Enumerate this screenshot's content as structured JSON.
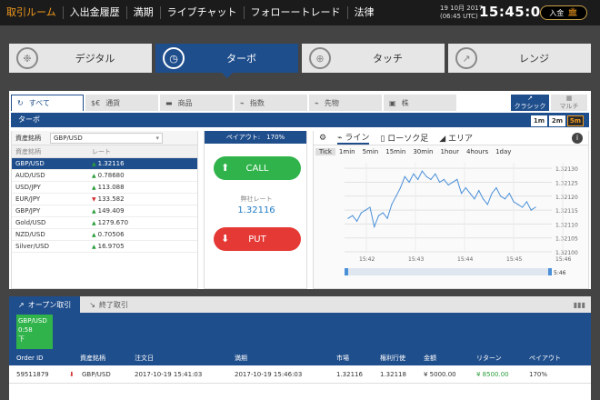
{
  "nav": {
    "items": [
      "取引ルーム",
      "入出金履歴",
      "満期",
      "ライブチャット",
      "フォローートレード",
      "法律"
    ]
  },
  "header": {
    "date": "19 10月 2017",
    "utc": "(06:45 UTC)",
    "time": "15:45:04",
    "deposit_label": "入金"
  },
  "modes": [
    {
      "label": "デジタル",
      "icon": "digital-icon"
    },
    {
      "label": "ターボ",
      "icon": "turbo-clock-icon"
    },
    {
      "label": "タッチ",
      "icon": "touch-target-icon"
    },
    {
      "label": "レンジ",
      "icon": "range-icon"
    }
  ],
  "asset_tabs": [
    {
      "label": "すべて",
      "icon": "all-icon"
    },
    {
      "label": "通貨",
      "icon": "currency-icon"
    },
    {
      "label": "商品",
      "icon": "commodity-icon"
    },
    {
      "label": "指数",
      "icon": "index-icon"
    },
    {
      "label": "先物",
      "icon": "futures-icon"
    },
    {
      "label": "株",
      "icon": "stock-icon"
    }
  ],
  "views": {
    "classic": "クラシック",
    "multi": "マルチ"
  },
  "turbo_title": "ターボ",
  "timeframes": [
    "1m",
    "2m",
    "5m"
  ],
  "asset_panel": {
    "select_label": "資産銘柄",
    "select_value": "GBP/USD",
    "col_asset": "資産銘柄",
    "col_rate": "レート",
    "rows": [
      {
        "asset": "GBP/USD",
        "rate": "1.32116",
        "dir": "up"
      },
      {
        "asset": "AUD/USD",
        "rate": "0.78680",
        "dir": "up"
      },
      {
        "asset": "USD/JPY",
        "rate": "113.088",
        "dir": "up"
      },
      {
        "asset": "EUR/JPY",
        "rate": "133.582",
        "dir": "down"
      },
      {
        "asset": "GBP/JPY",
        "rate": "149.409",
        "dir": "up"
      },
      {
        "asset": "Gold/USD",
        "rate": "1279.670",
        "dir": "up"
      },
      {
        "asset": "NZD/USD",
        "rate": "0.70506",
        "dir": "up"
      },
      {
        "asset": "Silver/USD",
        "rate": "16.9705",
        "dir": "up"
      }
    ]
  },
  "trade": {
    "payout": "ペイアウト:　170%",
    "call": "CALL",
    "put": "PUT",
    "rate_label": "弊社レート",
    "rate_value": "1.32116"
  },
  "chart_tabs": {
    "line": "ライン",
    "candle": "ローソク足",
    "area": "エリア"
  },
  "chart_times": [
    "Tick",
    "1min",
    "5min",
    "15min",
    "30min",
    "1hour",
    "4hours",
    "1day"
  ],
  "chart_data": {
    "type": "line",
    "x_labels": [
      "15:42",
      "15:43",
      "15:44",
      "15:45",
      "15:46"
    ],
    "y_labels": [
      "1.32130",
      "1.32125",
      "1.32120",
      "1.32115",
      "1.32110",
      "1.32105",
      "1.32100"
    ],
    "ylim": [
      1.321,
      1.32132
    ],
    "values": [
      1.32112,
      1.32113,
      1.32111,
      1.32114,
      1.32115,
      1.32116,
      1.32109,
      1.32113,
      1.32114,
      1.32112,
      1.32117,
      1.3212,
      1.32123,
      1.32127,
      1.32125,
      1.32128,
      1.32126,
      1.32129,
      1.32127,
      1.32126,
      1.32128,
      1.32125,
      1.32126,
      1.32124,
      1.32125,
      1.32126,
      1.32121,
      1.32123,
      1.32121,
      1.32119,
      1.32122,
      1.32119,
      1.32117,
      1.32121,
      1.32123,
      1.3212,
      1.32119,
      1.32121,
      1.32118,
      1.32117,
      1.32116,
      1.32118,
      1.32115,
      1.32116
    ],
    "marker_label": "5:46"
  },
  "bottom": {
    "tab_open": "オープン取引",
    "tab_closed": "終了取引",
    "card_asset": "GBP/USD",
    "card_time": "0:58",
    "card_dir": "下",
    "columns": [
      "Order ID",
      "資産銘柄",
      "注文日",
      "満期",
      "市場",
      "権利行使",
      "金額",
      "リターン",
      "ペイアウト"
    ],
    "row": {
      "order_id": "59511879",
      "asset": "GBP/USD",
      "order_date": "2017-10-19 15:41:03",
      "expiry": "2017-10-19 15:46:03",
      "market": "1.32116",
      "strike": "1.32118",
      "amount": "¥ 5000.00",
      "return": "¥ 8500.00",
      "payout": "170%"
    }
  }
}
